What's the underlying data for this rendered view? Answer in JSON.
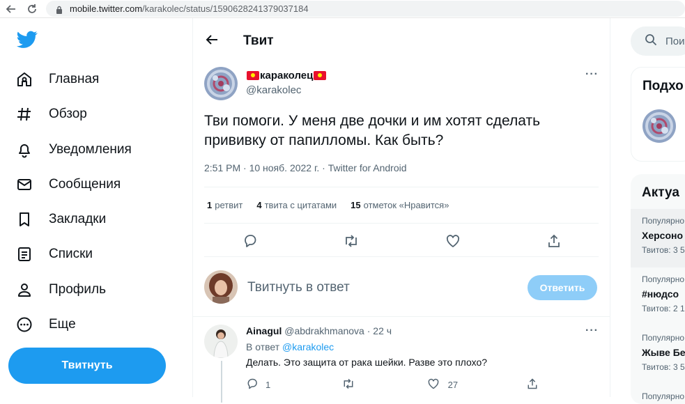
{
  "browser": {
    "url_domain": "mobile.twitter.com",
    "url_path": "/karakolec/status/1590628241379037184"
  },
  "sidebar": {
    "items": [
      {
        "label": "Главная",
        "icon": "home-icon"
      },
      {
        "label": "Обзор",
        "icon": "hash-icon"
      },
      {
        "label": "Уведомления",
        "icon": "bell-icon"
      },
      {
        "label": "Сообщения",
        "icon": "envelope-icon"
      },
      {
        "label": "Закладки",
        "icon": "bookmark-icon"
      },
      {
        "label": "Списки",
        "icon": "list-icon"
      },
      {
        "label": "Профиль",
        "icon": "person-icon"
      },
      {
        "label": "Еще",
        "icon": "more-circle-icon"
      }
    ],
    "tweet_button": "Твитнуть"
  },
  "header": {
    "title": "Твит"
  },
  "tweet": {
    "author_name": "караколец",
    "author_handle": "@karakolec",
    "text": "Тви помоги. У меня две дочки и им хотят сделать прививку от папилломы. Как быть?",
    "meta": "2:51 PM · 10 нояб. 2022 г. · Twitter for Android",
    "stats": {
      "retweets_count": "1",
      "retweets_label": "ретвит",
      "quotes_count": "4",
      "quotes_label": "твита с цитатами",
      "likes_count": "15",
      "likes_label": "отметок «Нравится»"
    }
  },
  "reply_composer": {
    "placeholder": "Твитнуть в ответ",
    "button": "Ответить"
  },
  "reply": {
    "name": "Ainagul",
    "handle_time": "@abdrakhmanova · 22 ч",
    "reply_to_prefix": "В ответ",
    "reply_to_handle": "@karakolec",
    "text": "Делать. Это защита от рака шейки. Разве это плохо?",
    "reply_count": "1",
    "like_count": "27"
  },
  "right": {
    "search_placeholder": "Пои",
    "card1_title": "Подхо",
    "card2_title": "Актуа",
    "trends": [
      {
        "category": "Популярно",
        "title": "Херсоно",
        "count": "Твитов: 3 5"
      },
      {
        "category": "Популярно",
        "title": "#нюдсо",
        "count": "Твитов: 2 1"
      },
      {
        "category": "Популярно",
        "title": "Жыве Бе",
        "count": "Твитов: 3 5"
      },
      {
        "category": "Популярно",
        "title": "",
        "count": ""
      }
    ]
  },
  "colors": {
    "accent": "#1d9bf0",
    "reply_button_disabled": "#8ecdf8",
    "muted_text": "#536471"
  }
}
